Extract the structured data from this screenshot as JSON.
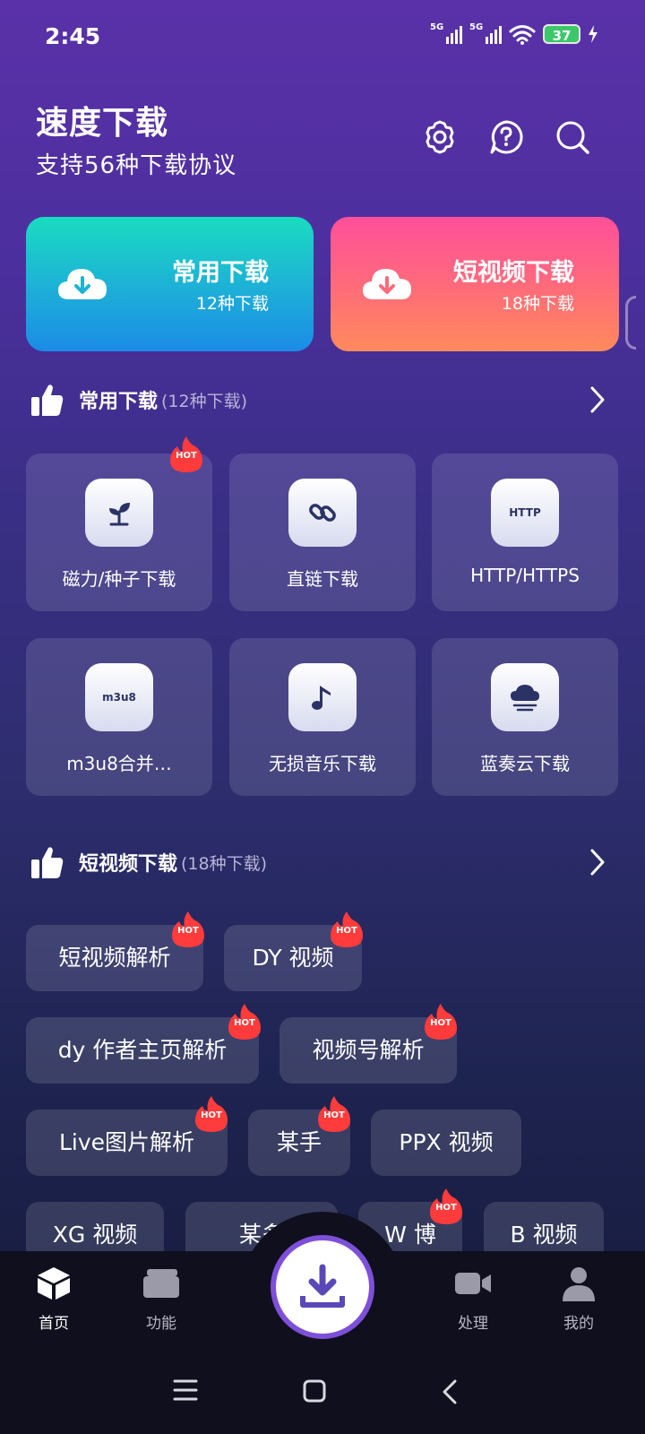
{
  "status": {
    "time": "2:45",
    "net1": "5G",
    "net2": "5G",
    "battery": "37"
  },
  "header": {
    "title": "速度下载",
    "subtitle": "支持56种下载协议"
  },
  "big_cards": [
    {
      "title": "常用下载",
      "count": "12种下载",
      "color": "#1db3d6"
    },
    {
      "title": "短视频下载",
      "count": "18种下载",
      "color": "#ff6a7b"
    }
  ],
  "sections": {
    "common": {
      "title": "常用下载",
      "count": "(12种下载)"
    },
    "short": {
      "title": "短视频下载",
      "count": "(18种下载)"
    }
  },
  "tiles": [
    {
      "label": "磁力/种子下载",
      "icon": "sprout-icon",
      "hot": true
    },
    {
      "label": "直链下载",
      "icon": "link-icon"
    },
    {
      "label": "HTTP/HTTPS",
      "icon": "http-icon",
      "icon_text": "HTTP"
    },
    {
      "label": "m3u8合并…",
      "icon": "m3u8-icon",
      "icon_text": "m3u8"
    },
    {
      "label": "无损音乐下载",
      "icon": "music-note-icon"
    },
    {
      "label": "蓝奏云下载",
      "icon": "cloud-icon"
    }
  ],
  "chips": [
    {
      "label": "短视频解析",
      "hot": true
    },
    {
      "label": "DY 视频",
      "hot": true
    },
    {
      "label": "dy 作者主页解析",
      "hot": true
    },
    {
      "label": "视频号解析",
      "hot": true
    },
    {
      "label": "Live图片解析",
      "hot": true
    },
    {
      "label": "某手",
      "hot": true
    },
    {
      "label": "PPX 视频",
      "hot": false
    },
    {
      "label": "XG 视频",
      "hot": false
    },
    {
      "label": "某多",
      "hot": false
    },
    {
      "label": "W 博",
      "hot": true
    },
    {
      "label": "B 视频",
      "hot": false
    }
  ],
  "hot_label": "HOT",
  "nav": [
    {
      "label": "首页",
      "icon": "home-cube-icon",
      "active": true
    },
    {
      "label": "功能",
      "icon": "cards-icon"
    },
    {
      "label": "处理",
      "icon": "video-camera-icon"
    },
    {
      "label": "我的",
      "icon": "person-icon"
    }
  ],
  "colors": {
    "accent": "#7e4fd8",
    "hot": "#ff3b3b"
  }
}
